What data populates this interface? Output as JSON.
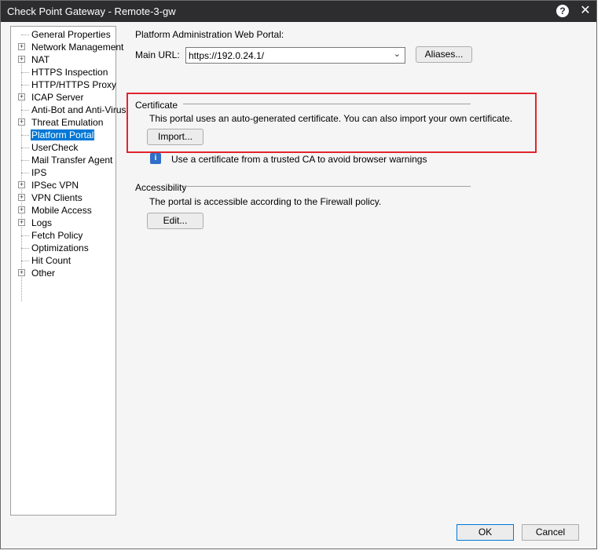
{
  "window": {
    "title": "Check Point Gateway - Remote-3-gw",
    "help_icon": "?",
    "close_icon": "✕"
  },
  "tree": {
    "items": [
      {
        "label": "General Properties",
        "expandable": false
      },
      {
        "label": "Network Management",
        "expandable": true
      },
      {
        "label": "NAT",
        "expandable": true
      },
      {
        "label": "HTTPS Inspection",
        "expandable": false
      },
      {
        "label": "HTTP/HTTPS Proxy",
        "expandable": false
      },
      {
        "label": "ICAP Server",
        "expandable": true
      },
      {
        "label": "Anti-Bot and Anti-Virus",
        "expandable": false
      },
      {
        "label": "Threat Emulation",
        "expandable": true
      },
      {
        "label": "Platform Portal",
        "expandable": false,
        "selected": true
      },
      {
        "label": "UserCheck",
        "expandable": false
      },
      {
        "label": "Mail Transfer Agent",
        "expandable": false
      },
      {
        "label": "IPS",
        "expandable": false
      },
      {
        "label": "IPSec VPN",
        "expandable": true
      },
      {
        "label": "VPN Clients",
        "expandable": true
      },
      {
        "label": "Mobile Access",
        "expandable": true
      },
      {
        "label": "Logs",
        "expandable": true
      },
      {
        "label": "Fetch Policy",
        "expandable": false
      },
      {
        "label": "Optimizations",
        "expandable": false
      },
      {
        "label": "Hit Count",
        "expandable": false
      },
      {
        "label": "Other",
        "expandable": true
      }
    ]
  },
  "portal": {
    "heading": "Platform Administration Web Portal:",
    "main_url_label": "Main URL:",
    "main_url_value": "https://192.0.24.1/",
    "aliases_button": "Aliases..."
  },
  "certificate": {
    "heading": "Certificate",
    "description": "This portal uses an auto-generated certificate. You can also import your own certificate.",
    "import_button": "Import...",
    "info_text": "Use a certificate from a trusted CA to avoid browser warnings"
  },
  "accessibility": {
    "heading": "Accessibility",
    "description": "The portal is accessible according to the Firewall policy.",
    "edit_button": "Edit..."
  },
  "footer": {
    "ok_button": "OK",
    "cancel_button": "Cancel"
  },
  "colors": {
    "highlight_border": "#e0262b",
    "selection": "#0078d7",
    "titlebar": "#2d2d30"
  }
}
